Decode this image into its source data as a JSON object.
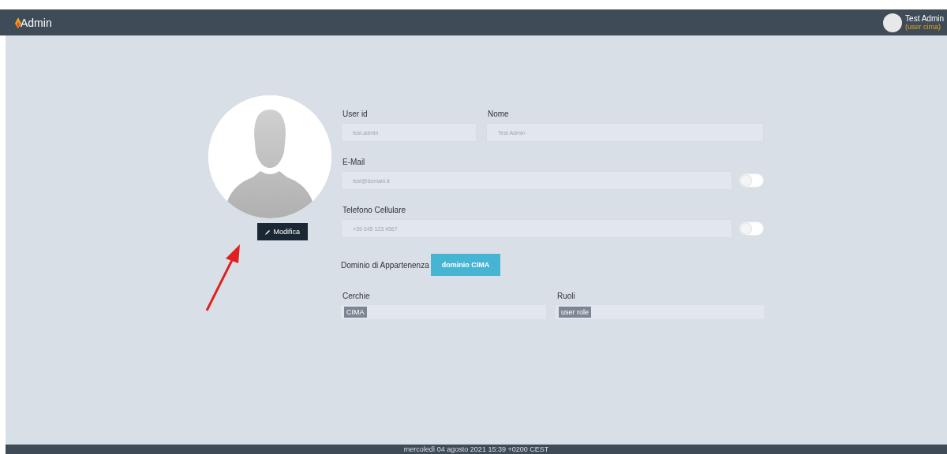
{
  "header": {
    "logo": "Admin",
    "user": {
      "name": "Test Admin",
      "role": "(user cima)"
    }
  },
  "profile": {
    "edit_button": "Modifica"
  },
  "form": {
    "user_id": {
      "label": "User id",
      "value": "test.admin"
    },
    "nome": {
      "label": "Nome",
      "value": "Test Admin"
    },
    "email": {
      "label": "E-Mail",
      "value": "test@domain.it",
      "on": false
    },
    "phone": {
      "label": "Telefono Cellulare",
      "value": "+39 345 123 4567",
      "on": false
    },
    "domain": {
      "label": "Dominio di Appartenenza",
      "button": "dominio CIMA"
    },
    "cerchie": {
      "label": "Cerchie",
      "tags": [
        "CIMA"
      ]
    },
    "ruoli": {
      "label": "Ruoli",
      "tags": [
        "user role"
      ]
    }
  },
  "footer": {
    "text": "mercoledì 04 agosto 2021 15:39 +0200 CEST"
  }
}
